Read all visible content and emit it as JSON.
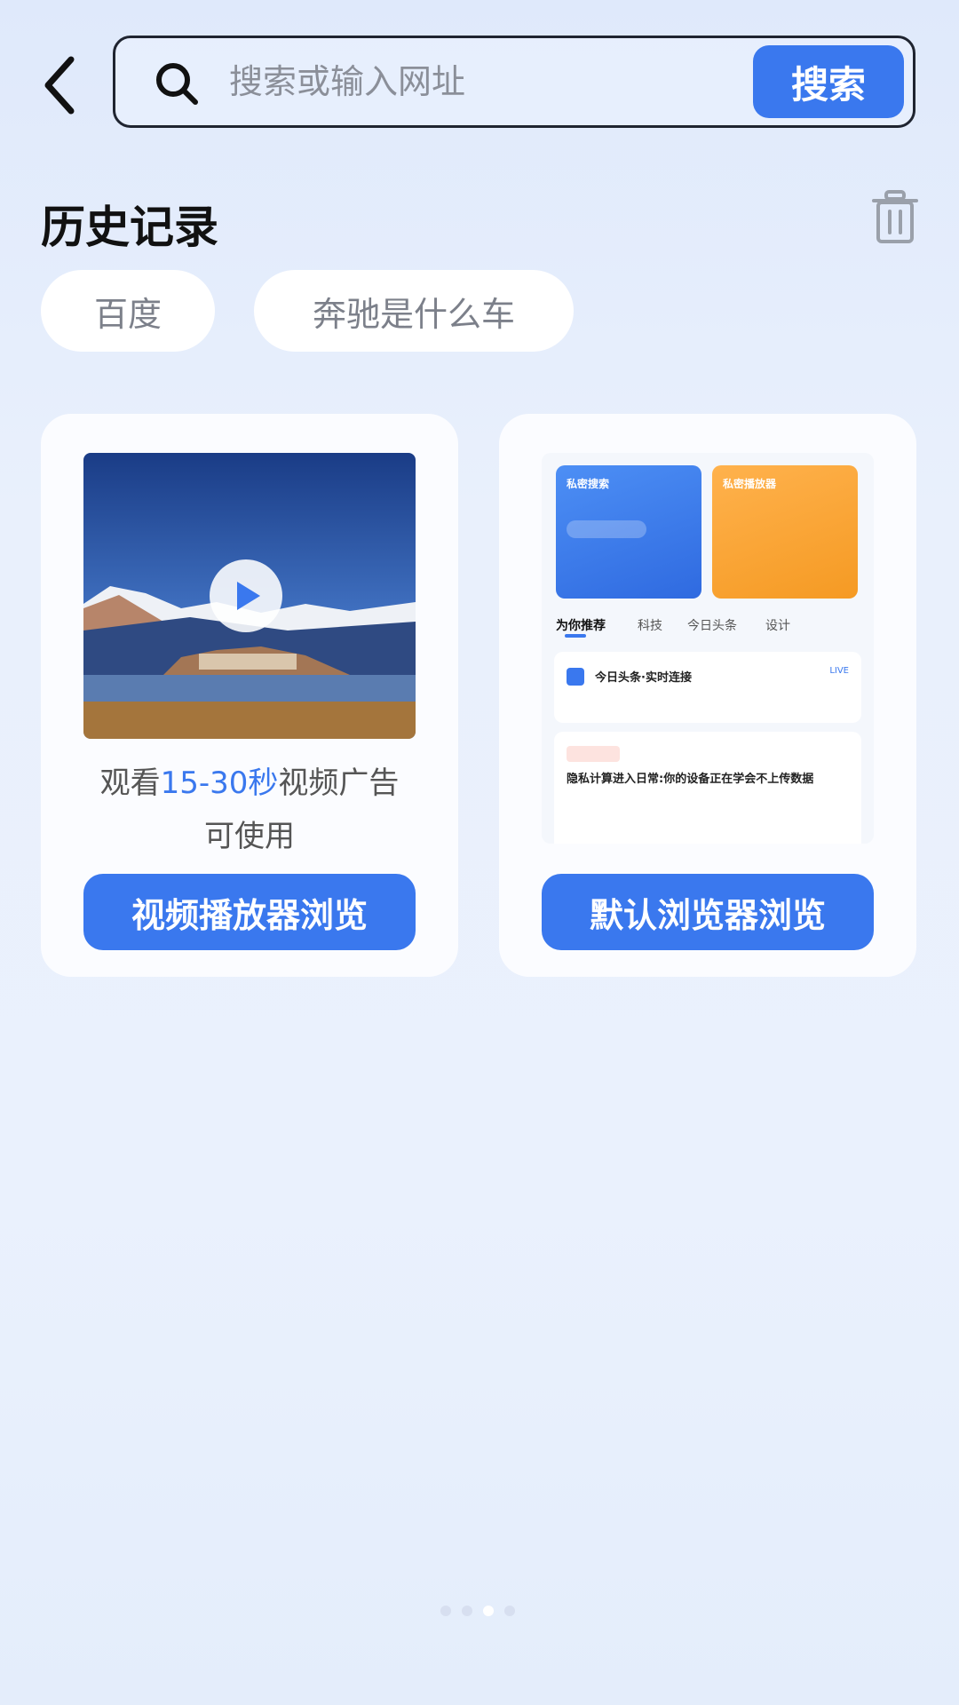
{
  "search": {
    "placeholder": "搜索或输入网址",
    "button_label": "搜索"
  },
  "history": {
    "title": "历史记录",
    "chips": [
      "百度",
      "奔驰是什么车"
    ]
  },
  "cards": {
    "video": {
      "ad_prefix": "观看",
      "ad_highlight": "15-30秒",
      "ad_suffix": "视频广告",
      "ad_line2": "可使用",
      "button_label": "视频播放器浏览"
    },
    "browser": {
      "button_label": "默认浏览器浏览",
      "preview": {
        "tiles": [
          "私密搜索",
          "私密播放器"
        ],
        "tabs": [
          "为你推荐",
          "科技",
          "今日头条",
          "设计"
        ],
        "item1_title": "今日头条·实时连接",
        "item1_badge": "LIVE",
        "item2_title": "隐私计算进入日常:你的设备正在学会不上传数据"
      }
    }
  },
  "pager": {
    "count": 4,
    "active_index": 2
  },
  "colors": {
    "accent": "#3a78ee",
    "background": "#e9f0fc"
  }
}
